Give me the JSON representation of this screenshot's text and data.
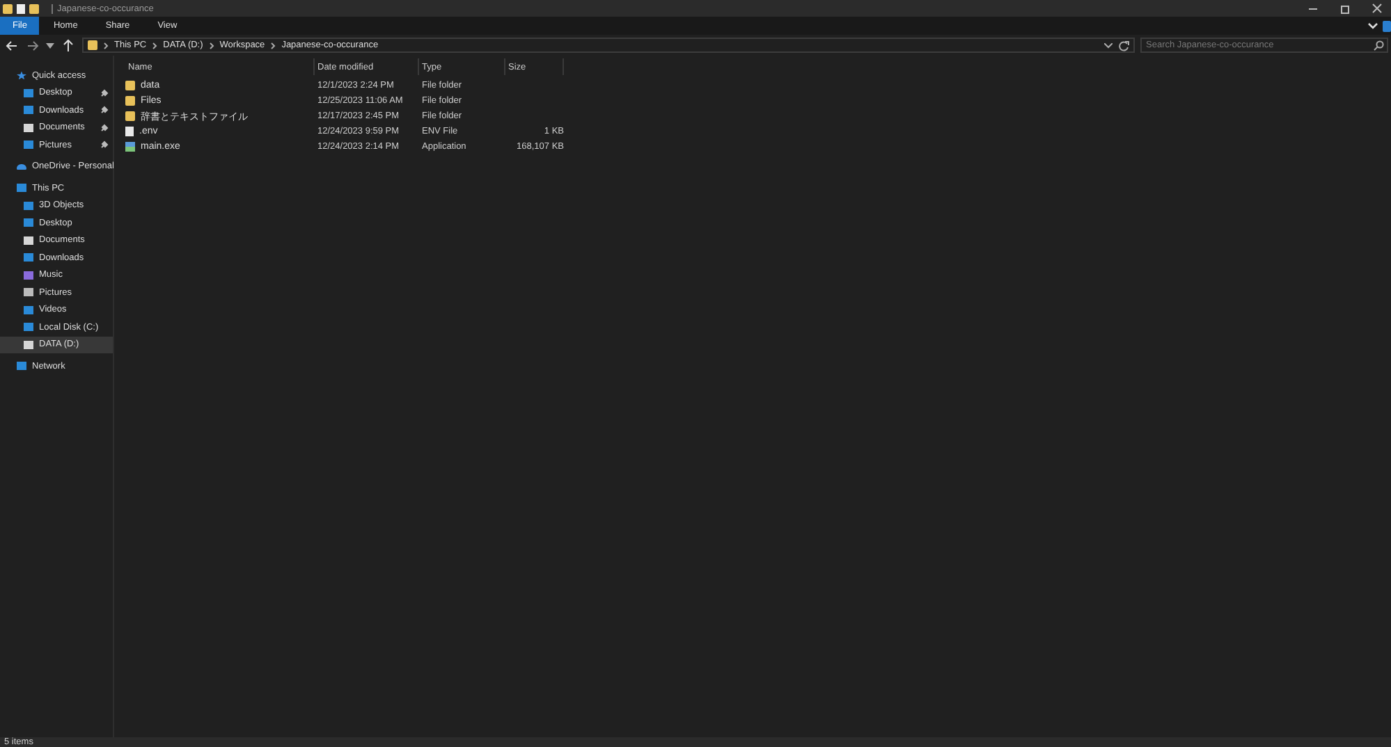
{
  "window": {
    "title": "Japanese-co-occurance"
  },
  "ribbon_tabs": [
    {
      "label": "File",
      "selected": true
    },
    {
      "label": "Home",
      "selected": false
    },
    {
      "label": "Share",
      "selected": false
    },
    {
      "label": "View",
      "selected": false
    }
  ],
  "address": {
    "path": [
      "This PC",
      "DATA (D:)",
      "Workspace",
      "Japanese-co-occurance"
    ]
  },
  "search": {
    "placeholder": "Search Japanese-co-occurance"
  },
  "sidebar": {
    "items": [
      {
        "label": "Quick access",
        "selected": false,
        "children": [
          {
            "label": "Desktop",
            "pinned": true,
            "selected": false
          },
          {
            "label": "Downloads",
            "pinned": true,
            "selected": false
          },
          {
            "label": "Documents",
            "pinned": true,
            "selected": false
          },
          {
            "label": "Pictures",
            "pinned": true,
            "selected": false
          }
        ]
      },
      {
        "label": "OneDrive - Personal",
        "selected": false
      },
      {
        "label": "This PC",
        "selected": false,
        "children": [
          {
            "label": "3D Objects",
            "pinned": false,
            "selected": false
          },
          {
            "label": "Desktop",
            "pinned": false,
            "selected": false
          },
          {
            "label": "Documents",
            "pinned": false,
            "selected": false
          },
          {
            "label": "Downloads",
            "pinned": false,
            "selected": false
          },
          {
            "label": "Music",
            "pinned": false,
            "selected": false
          },
          {
            "label": "Pictures",
            "pinned": false,
            "selected": false
          },
          {
            "label": "Videos",
            "pinned": false,
            "selected": false
          },
          {
            "label": "Local Disk (C:)",
            "pinned": false,
            "selected": false
          },
          {
            "label": "DATA (D:)",
            "pinned": false,
            "selected": true
          }
        ]
      },
      {
        "label": "Network",
        "selected": false
      }
    ]
  },
  "table": {
    "columns": [
      "Name",
      "Date modified",
      "Type",
      "Size"
    ],
    "rows": [
      {
        "name": "data",
        "date": "12/1/2023 2:24 PM",
        "type": "File folder",
        "kind": "folder"
      },
      {
        "name": "Files",
        "date": "12/25/2023 11:06 AM",
        "type": "File folder",
        "kind": "folder"
      },
      {
        "name": "辞書とテキストファイル",
        "date": "12/17/2023 2:45 PM",
        "type": "File folder",
        "kind": "folder"
      },
      {
        "name": ".env",
        "date": "12/24/2023 9:59 PM",
        "type": "ENV File",
        "size": "1 KB",
        "kind": "file"
      },
      {
        "name": "main.exe",
        "date": "12/24/2023 2:14 PM",
        "type": "Application",
        "size": "168,107 KB",
        "kind": "app"
      }
    ]
  },
  "status_bar": {
    "text": "5 items"
  }
}
